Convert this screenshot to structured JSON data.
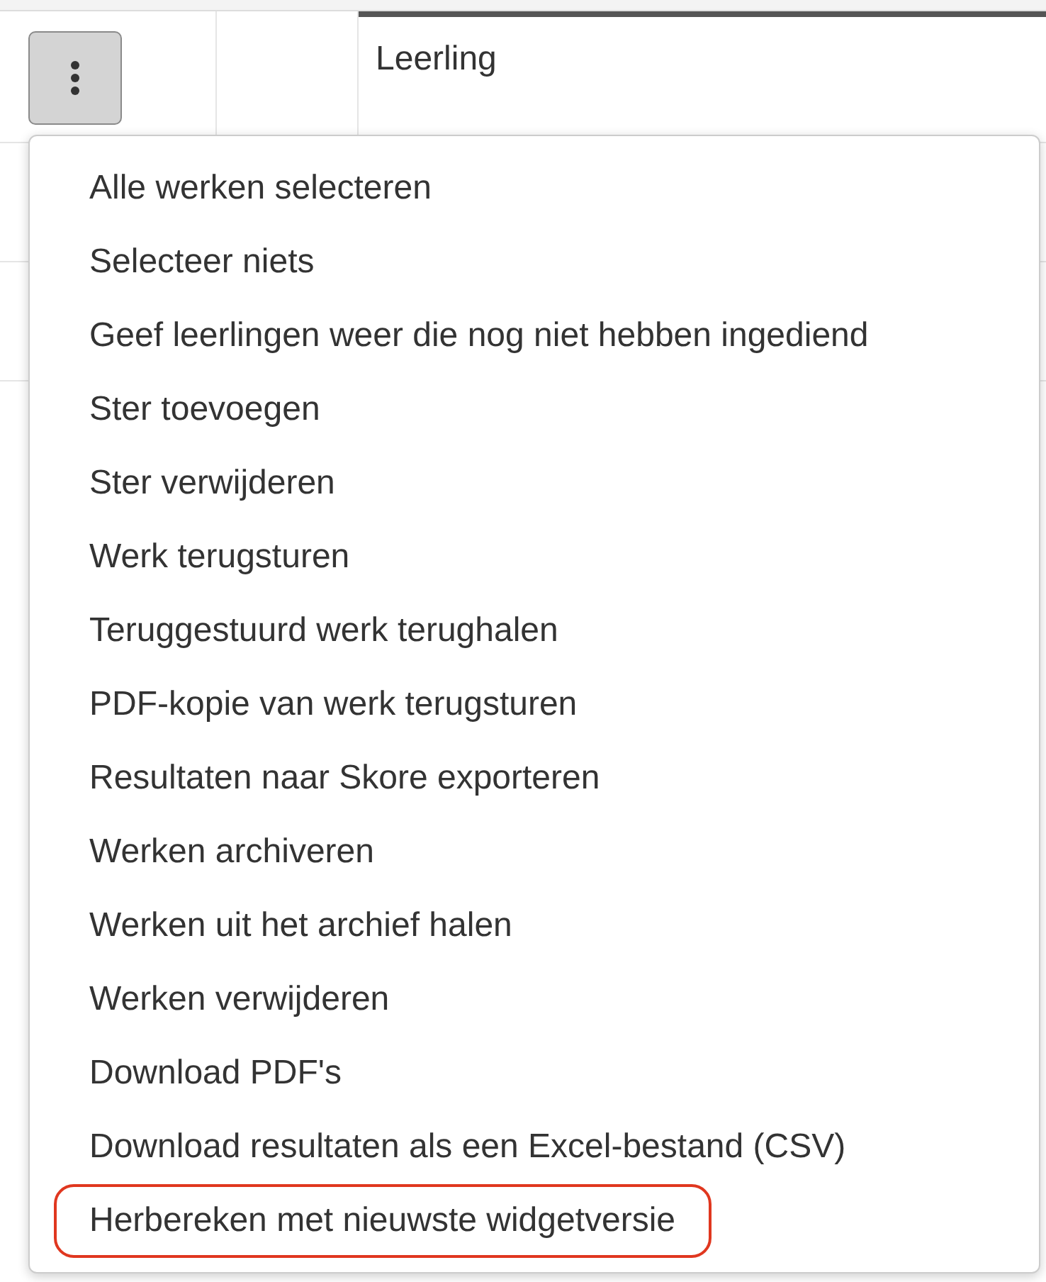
{
  "table": {
    "header": {
      "column_3": "Leerling"
    }
  },
  "menu": {
    "items": [
      {
        "label": "Alle werken selecteren",
        "highlighted": false
      },
      {
        "label": "Selecteer niets",
        "highlighted": false
      },
      {
        "label": "Geef leerlingen weer die nog niet hebben ingediend",
        "highlighted": false
      },
      {
        "label": "Ster toevoegen",
        "highlighted": false
      },
      {
        "label": "Ster verwijderen",
        "highlighted": false
      },
      {
        "label": "Werk terugsturen",
        "highlighted": false
      },
      {
        "label": "Teruggestuurd werk terughalen",
        "highlighted": false
      },
      {
        "label": "PDF-kopie van werk terugsturen",
        "highlighted": false
      },
      {
        "label": "Resultaten naar Skore exporteren",
        "highlighted": false
      },
      {
        "label": "Werken archiveren",
        "highlighted": false
      },
      {
        "label": "Werken uit het archief halen",
        "highlighted": false
      },
      {
        "label": "Werken verwijderen",
        "highlighted": false
      },
      {
        "label": "Download PDF's",
        "highlighted": false
      },
      {
        "label": "Download resultaten als een Excel-bestand (CSV)",
        "highlighted": false
      },
      {
        "label": "Herbereken met nieuwste widgetversie",
        "highlighted": true
      }
    ]
  }
}
